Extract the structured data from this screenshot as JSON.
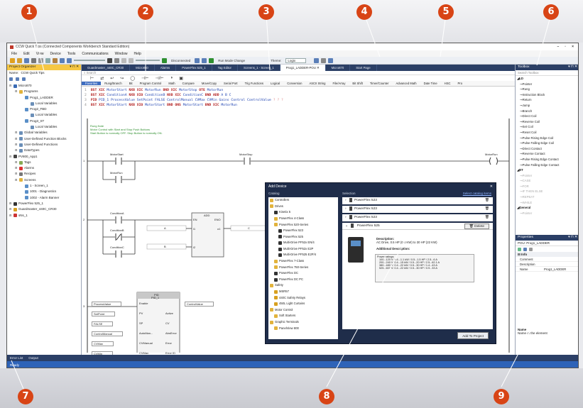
{
  "window": {
    "title": "CCW Quick Tips (Connected Components Workbench Standard Edition)",
    "controls": [
      "–",
      "▫",
      "×"
    ]
  },
  "menu": [
    "File",
    "Edit",
    "View",
    "Device",
    "Tools",
    "Communications",
    "Window",
    "Help"
  ],
  "toolbar": {
    "connection_status": "Disconnected",
    "run_mode_change": "Run Mode Change",
    "theme_label": "Theme:",
    "theme_value": "Logix"
  },
  "doc_tabs": [
    "Guardmaster_440C_CR30",
    "Micro850",
    "Alarms",
    "PowerFlex 525_1",
    "Tag Editor",
    "Screens_1 - Screen_1",
    "Prog1_LADDER-POU",
    "Micro870",
    "Start Page"
  ],
  "project_organizer": {
    "title": "Project Organizer",
    "name_label": "Name:",
    "name_value": "CCW Quick Tips",
    "tree": [
      {
        "label": "Micro870",
        "level": 0,
        "icon": "controller"
      },
      {
        "label": "Programs",
        "level": 1,
        "icon": "folder"
      },
      {
        "label": "Prog1_LADDER",
        "level": 2,
        "icon": "ladder"
      },
      {
        "label": "Local Variables",
        "level": 3,
        "icon": "table"
      },
      {
        "label": "Prog2_FBD",
        "level": 2,
        "icon": "ladder"
      },
      {
        "label": "Local Variables",
        "level": 3,
        "icon": "table"
      },
      {
        "label": "Prog3_ST",
        "level": 2,
        "icon": "ladder"
      },
      {
        "label": "Local Variables",
        "level": 3,
        "icon": "table"
      },
      {
        "label": "Global Variables",
        "level": 1,
        "icon": "table"
      },
      {
        "label": "User-Defined Function Blocks",
        "level": 1,
        "icon": "table"
      },
      {
        "label": "User-Defined Functions",
        "level": 1,
        "icon": "table"
      },
      {
        "label": "DataTypes",
        "level": 1,
        "icon": "table"
      },
      {
        "label": "PV800_App1",
        "level": 0,
        "icon": "hmi"
      },
      {
        "label": "Tags",
        "level": 1,
        "icon": "tag"
      },
      {
        "label": "Alarms",
        "level": 1,
        "icon": "alarm"
      },
      {
        "label": "Recipes",
        "level": 1,
        "icon": "recipe"
      },
      {
        "label": "Screens",
        "level": 1,
        "icon": "folder"
      },
      {
        "label": "1 - Screen_1",
        "level": 2,
        "icon": "screen"
      },
      {
        "label": "1001 - Diagnostics",
        "level": 2,
        "icon": "screen"
      },
      {
        "label": "1002 - Alarm Banner",
        "level": 2,
        "icon": "screen"
      },
      {
        "label": "PowerFlex 525_1",
        "level": 0,
        "icon": "drive"
      },
      {
        "label": "Guardmaster_440C_CR30",
        "level": 0,
        "icon": "safety"
      },
      {
        "label": "sNs_1",
        "level": 0,
        "icon": "device"
      }
    ]
  },
  "editor": {
    "search_placeholder": "Search",
    "instruction_tabs": [
      "Favorites",
      "Rung/Branch",
      "Bit",
      "Program Control",
      "Math",
      "Compare",
      "Move/Copy",
      "Serial Port",
      "Trig Functions",
      "Logical",
      "Conversion",
      "ASCII String",
      "File/Array",
      "Bit Shift",
      "Timer/Counter",
      "Advanced Math",
      "Date Time",
      "HSC",
      "Pro"
    ],
    "st_lines": [
      {
        "num": "1",
        "text": "BST XIC MotorStart NXB XIC MotorRun BND XIC MotorStop OTE MotorRun"
      },
      {
        "num": "2",
        "text": "BST XIC ConditionA NXB XIO ConditionB NXB XIC ConditionC BND ADD A B C"
      },
      {
        "num": "3",
        "text": "PID PID_1 ProcessValue SetPoint FALSE ControlManual CVMax CVMin Gains Control ControlValue ? ? ?"
      },
      {
        "num": "4",
        "text": "BST XIC MotorStart NXB XIO MotorStart BND ONS MotorStart BND XIC MotorRun"
      }
    ],
    "rung1_comment": [
      "Rung Note",
      "Motor Control with Start and Stop Push Buttons",
      "Start Button is normally OFF.  Stop Button is normally ON."
    ],
    "rung1_tags": [
      "MotorStart",
      "MotorStop",
      "MotorRun",
      "MotorRun"
    ],
    "rung2_tags": [
      "ConditionA",
      "ConditionB",
      "ConditionC"
    ],
    "add_block": {
      "name": "ADD",
      "pins_in": [
        "EN",
        "i1",
        "i2"
      ],
      "pins_out": [
        "ENO",
        "o1"
      ],
      "args": [
        "A",
        "B",
        "C"
      ]
    },
    "pid_block": {
      "name": "PID",
      "instance": "PID_1",
      "pins_in": [
        "Enable",
        "PV",
        "SP",
        "AutoMan...",
        "CVManual",
        "CVMax",
        "CVMin"
      ],
      "pins_out": [
        "Active",
        "CV",
        "AbsError",
        "Error",
        "Error ID"
      ],
      "args": [
        "ProcessValue",
        "SetPoint",
        "FALSE",
        "ControlManual",
        "CVMax",
        "CVMin",
        "ControlValue"
      ]
    },
    "rung_numbers": [
      "1",
      "2",
      "3"
    ]
  },
  "add_device": {
    "title": "Add Device",
    "catalog_label": "Catalog",
    "selection_label": "Selection",
    "select_link": "Select catalog items",
    "catalog_tree": [
      {
        "label": "Controllers",
        "level": 0,
        "icon": "folder"
      },
      {
        "label": "Drives",
        "level": 0,
        "icon": "folder"
      },
      {
        "label": "Kinetix 5",
        "level": 1,
        "icon": "drive"
      },
      {
        "label": "PowerFlex 4-Class",
        "level": 1,
        "icon": "folder"
      },
      {
        "label": "PowerFlex 520-Series",
        "level": 1,
        "icon": "folder"
      },
      {
        "label": "PowerFlex 523",
        "level": 2,
        "icon": "drive"
      },
      {
        "label": "PowerFlex 525",
        "level": 2,
        "icon": "drive"
      },
      {
        "label": "Multi-Drive PF52x EN/4",
        "level": 2,
        "icon": "drive"
      },
      {
        "label": "Multi-Drive PF52x E2P",
        "level": 2,
        "icon": "drive"
      },
      {
        "label": "Multi-Drive PF525 E2P/4",
        "level": 2,
        "icon": "drive"
      },
      {
        "label": "PowerFlex 7-Class",
        "level": 1,
        "icon": "folder"
      },
      {
        "label": "PowerFlex 750-Series",
        "level": 1,
        "icon": "folder"
      },
      {
        "label": "PowerFlex DC",
        "level": 1,
        "icon": "drive"
      },
      {
        "label": "PowerFlex DC PC",
        "level": 1,
        "icon": "drive"
      },
      {
        "label": "Safety",
        "level": 0,
        "icon": "folder"
      },
      {
        "label": "MSR57",
        "level": 1,
        "icon": "safety"
      },
      {
        "label": "440C Safety Relays",
        "level": 1,
        "icon": "safety"
      },
      {
        "label": "450L Light Curtains",
        "level": 1,
        "icon": "safety"
      },
      {
        "label": "Motor Control",
        "level": 0,
        "icon": "folder"
      },
      {
        "label": "Soft Starters",
        "level": 1,
        "icon": "folder"
      },
      {
        "label": "Graphic Terminals",
        "level": 0,
        "icon": "folder"
      },
      {
        "label": "PanelView 800",
        "level": 1,
        "icon": "folder"
      }
    ],
    "selection_items": [
      "PowerFlex 523",
      "PowerFlex 523",
      "PowerFlex 523"
    ],
    "expanded_item": "PowerFlex 525",
    "delete_label": "Delete",
    "description_label": "Description:",
    "description_text": "AC Drive, 0.5 HP (0.4 KW) to 30 HP (22 KW)",
    "additional_label": "Additional Description:",
    "power_ratings_label": "Power ratings:",
    "power_ratings": [
      "100...120 V: 0.4...1.1 kW / 0.5...1.5 HP / 2.5...6 A",
      "200...240 V: 0.4...15 kW / 0.5...20 HP / 2.5...62.1 A",
      "380...480 V: 0.4...22 kW / 0.5...30 HP / 1.4...43 A",
      "525...600 V: 0.4...22 kW / 0.5...30 HP / 0.9...33 A"
    ],
    "add_button": "Add To Project"
  },
  "toolbox": {
    "title": "Toolbox",
    "search_placeholder": "Search Toolbox",
    "section_ld": "LD",
    "items": [
      "Pointer",
      "Rung",
      "Instruction Block",
      "Return",
      "Jump",
      "Branch",
      "Direct Coil",
      "Reverse Coil",
      "Set Coil",
      "Reset Coil",
      "Pulse Rising Edge Coil",
      "Pulse Falling Edge Coil",
      "Direct Contact",
      "Reverse Contact",
      "Pulse Rising Edge Contact",
      "Pulse Falling Edge Contact"
    ],
    "section_st": "ST",
    "st_items": [
      "Pointer",
      "CASE",
      "FOR",
      "IF THEN ELSE",
      "REPEAT",
      "WHILE"
    ],
    "section_general": "General",
    "general_items": [
      "Pointer"
    ]
  },
  "properties": {
    "title": "Properties",
    "object": "POU: Prog1_LADDER",
    "category": "Info",
    "rows": [
      {
        "label": "Comment",
        "value": ""
      },
      {
        "label": "Description",
        "value": ""
      },
      {
        "label": "Name",
        "value": "Prog1_LADDER"
      }
    ],
    "help_title": "Name",
    "help_text": "Name of the element"
  },
  "bottom_tabs": [
    "Error List",
    "Output"
  ],
  "status": "Ready",
  "callouts": [
    "1",
    "2",
    "3",
    "4",
    "5",
    "6",
    "7",
    "8",
    "9"
  ],
  "colors": {
    "accent_orange": "#d84415",
    "panel_navy": "#2b3f66",
    "status_blue": "#2e63b8",
    "highlight_yellow": "#f6c743"
  }
}
